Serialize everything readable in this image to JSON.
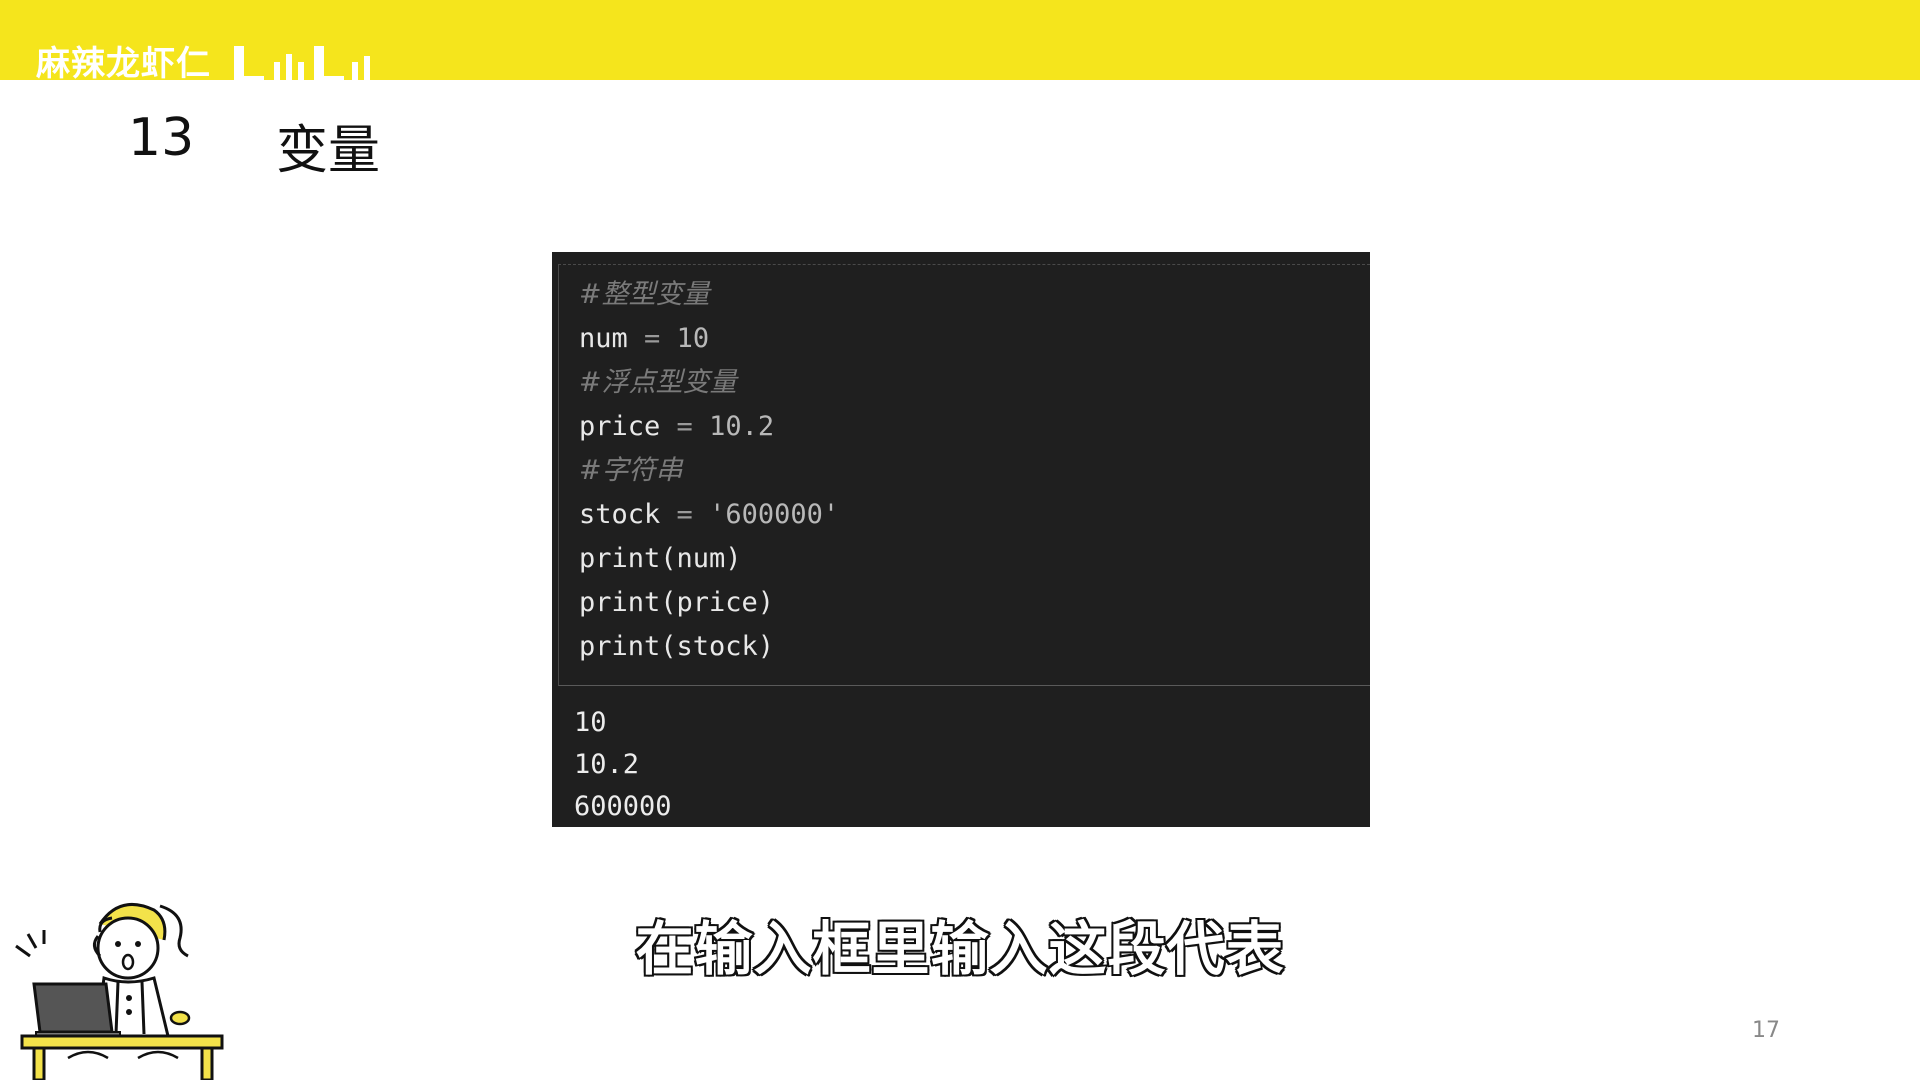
{
  "header": {
    "brand_text": "麻辣龙虾仁",
    "colors": {
      "bar": "#f5e51c",
      "brand_text": "#ffffff"
    }
  },
  "slide": {
    "number": "13",
    "title": "变量",
    "page_number": "17"
  },
  "code": {
    "comment_int": "#整型变量",
    "line_num": {
      "name": "num",
      "op": "=",
      "value": "10"
    },
    "comment_float": "#浮点型变量",
    "line_price": {
      "name": "price",
      "op": "=",
      "value": "10.2"
    },
    "comment_str": "#字符串",
    "line_stock": {
      "name": "stock",
      "op": "=",
      "value": "'600000'"
    },
    "print1": "print(num)",
    "print2": "print(price)",
    "print3": "print(stock)"
  },
  "output": {
    "lines": [
      "10",
      "10.2",
      "600000"
    ]
  },
  "subtitle": "在输入框里输入这段代表",
  "icons": {
    "mascot": "cartoon-person-at-laptop-icon"
  }
}
